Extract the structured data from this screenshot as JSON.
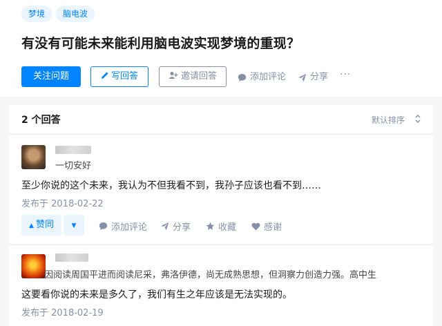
{
  "tags": [
    "梦境",
    "脑电波"
  ],
  "question": {
    "title": "有没有可能未来能利用脑电波实现梦境的重现？",
    "follow_label": "关注问题",
    "write_label": "写回答",
    "invite_label": "邀请回答",
    "comment_label": "添加评论",
    "share_label": "分享",
    "more_label": "···"
  },
  "answers_header": {
    "count_label": "2 个回答",
    "sort_label": "默认排序"
  },
  "answers": [
    {
      "headline": "一切安好",
      "content": "至少你说的这个未来，我认为不但我看不到，我孙子应该也看不到……",
      "date": "发布于 2018-02-22",
      "vote_label": "赞同",
      "actions": {
        "comment": "添加评论",
        "share": "分享",
        "favorite": "收藏",
        "thanks": "感谢"
      }
    },
    {
      "headline": "因阅读周国平进而阅读尼采，弗洛伊德，尚无成熟思想，但洞察力创造力强。高中生",
      "content": "这要看你说的未来是多久了，我们有生之年应该是无法实现的。",
      "date": "发布于 2018-02-19"
    }
  ],
  "colors": {
    "accent": "#0084ff",
    "accent_light": "#ebf5ff",
    "meta_gray": "#8590a6"
  }
}
